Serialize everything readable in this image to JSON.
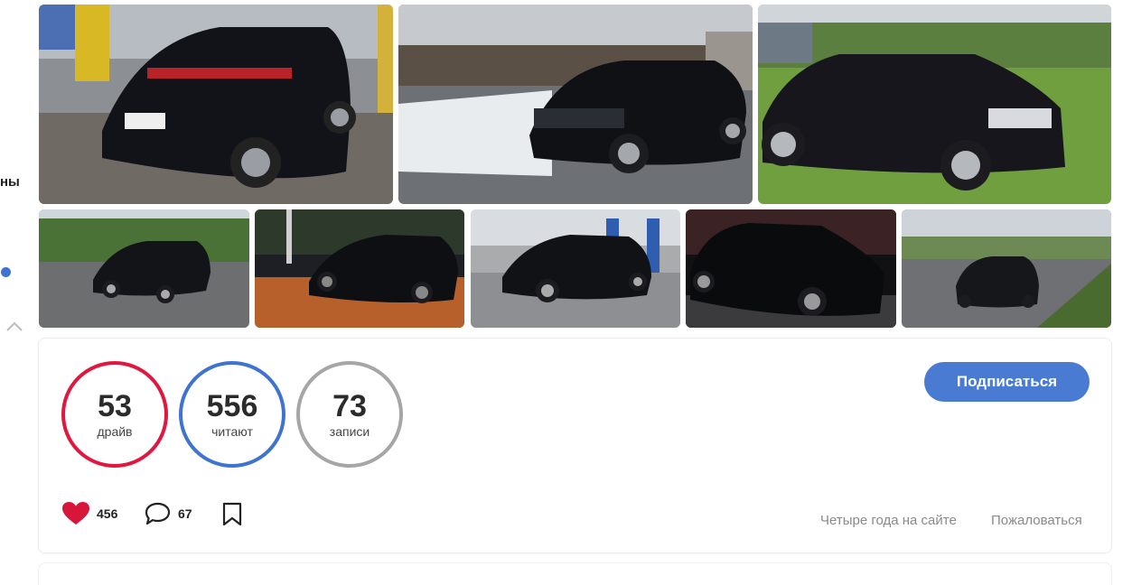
{
  "sidebar": {
    "fragment_text": "ны",
    "dot_color": "#3e73cf",
    "chevron_icon": "chevron-up-icon"
  },
  "gallery": {
    "photos": [
      {
        "name": "photo-parking-garage",
        "scene": "underground-parking"
      },
      {
        "name": "photo-snowy-lot",
        "scene": "snow"
      },
      {
        "name": "photo-green-field",
        "scene": "field"
      },
      {
        "name": "photo-wet-road",
        "scene": "wet-road"
      },
      {
        "name": "photo-night-street",
        "scene": "night-street"
      },
      {
        "name": "photo-service-garage",
        "scene": "service"
      },
      {
        "name": "photo-dark-night",
        "scene": "night"
      },
      {
        "name": "photo-highway-rear",
        "scene": "highway"
      }
    ]
  },
  "stats": {
    "drive": {
      "value": "53",
      "label": "драйв",
      "color": "#e0173f"
    },
    "readers": {
      "value": "556",
      "label": "читают",
      "color": "#3e73cf"
    },
    "posts": {
      "value": "73",
      "label": "записи",
      "color": "#a6a6a6"
    }
  },
  "subscribe": {
    "label": "Подписаться",
    "color": "#4a7bd3"
  },
  "actions": {
    "likes": {
      "count": "456",
      "icon": "heart-icon",
      "color": "#d8163c"
    },
    "comments": {
      "count": "67",
      "icon": "comment-icon"
    },
    "bookmark": {
      "icon": "bookmark-icon"
    }
  },
  "meta": {
    "since": "Четыре года на сайте",
    "report": "Пожаловаться"
  }
}
